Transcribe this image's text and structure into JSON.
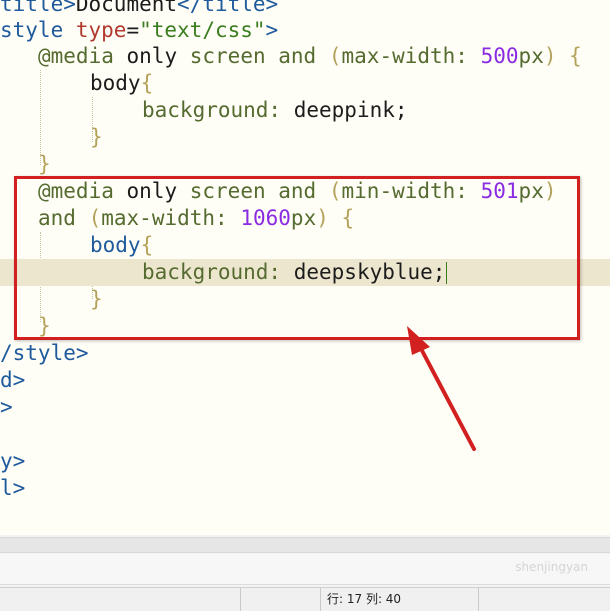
{
  "code": {
    "l0_tag": "title",
    "l0_text": "Document",
    "l0_close": "/title",
    "l1_tag": "style",
    "l1_attr": "type",
    "l1_val": "\"text/css\"",
    "media_at": "@media",
    "media_only": "only",
    "media_screen": "screen",
    "media_and": "and",
    "max_width_prop": "max-width:",
    "max_width_val1": "500",
    "min_width_prop": "min-width:",
    "min_width_val": "501",
    "max_width_val2": "1060",
    "px": "px",
    "body_sel": "body",
    "bg_prop": "background:",
    "bg_val1": "deeppink;",
    "bg_val2": "deepskyblue;",
    "style_close": "/style",
    "d_close": "d",
    "gt": ">",
    "y_close": "y",
    "l_close": "l"
  },
  "statusbar": {
    "position": "行: 17 列: 40"
  },
  "watermark": {
    "text": "shenjingyan"
  },
  "colors": {
    "annotation": "#d21f1f",
    "current_line": "#ede6cf"
  }
}
